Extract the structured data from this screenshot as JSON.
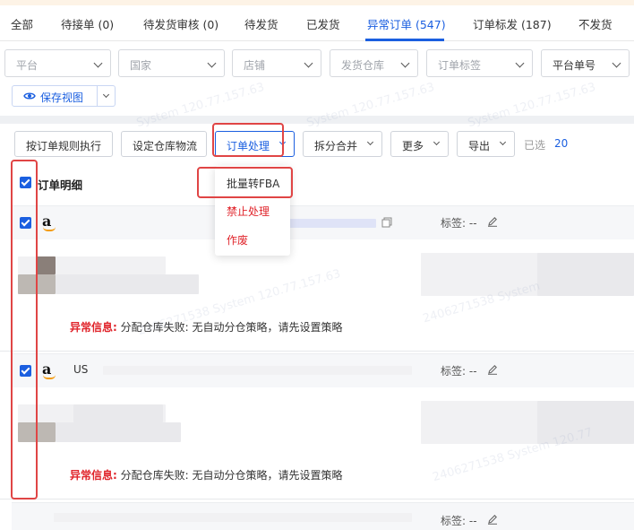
{
  "tabs": [
    {
      "label": "全部"
    },
    {
      "label": "待接单 (0)"
    },
    {
      "label": "待发货审核 (0)"
    },
    {
      "label": "待发货"
    },
    {
      "label": "已发货"
    },
    {
      "label": "异常订单 (547)"
    },
    {
      "label": "订单标发 (187)"
    },
    {
      "label": "不发货"
    }
  ],
  "active_tab": "异常订单 (547)",
  "filters": {
    "platform": "平台",
    "country": "国家",
    "store": "店铺",
    "warehouse": "发货仓库",
    "order_tag": "订单标签",
    "platform_order_no": "平台单号"
  },
  "save_view": {
    "label": "保存视图"
  },
  "actions": {
    "rule_exec": "按订单规则执行",
    "set_warehouse_logistics": "设定仓库物流",
    "order_process": "订单处理",
    "split_merge": "拆分合并",
    "more": "更多",
    "export": "导出",
    "selected_label": "已选",
    "selected_count": "20"
  },
  "table": {
    "header_title": "订单明细"
  },
  "dropdown": {
    "items": [
      {
        "label": "批量转FBA",
        "style": "normal"
      },
      {
        "label": "禁止处理",
        "style": "danger"
      },
      {
        "label": "作废",
        "style": "danger"
      }
    ]
  },
  "orders": [
    {
      "country": "",
      "tag_label": "标签: --",
      "exception_key": "异常信息:",
      "exception_value": "分配仓库失败: 无自动分仓策略，请先设置策略"
    },
    {
      "country": "US",
      "tag_label": "标签: --",
      "exception_key": "异常信息:",
      "exception_value": "分配仓库失败: 无自动分仓策略，请先设置策略"
    },
    {
      "country": "",
      "tag_label": "标签: --"
    }
  ],
  "colors": {
    "accent": "#1b5fe0",
    "danger": "#e0242b",
    "highlight_box": "#e04545"
  }
}
